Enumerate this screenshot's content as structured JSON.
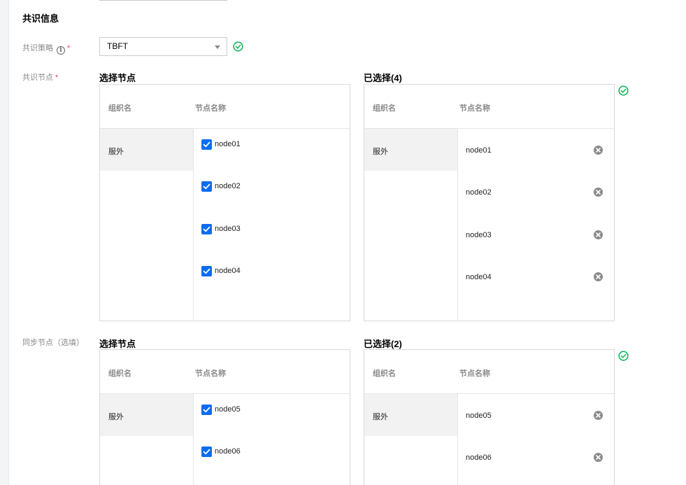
{
  "section": {
    "title": "共识信息"
  },
  "consensus": {
    "label": "共识策略",
    "info_glyph": "i",
    "required_mark": "*",
    "value": "TBFT",
    "status_icon": "check-circle-icon",
    "status_color": "#16b85c"
  },
  "consensus_nodes": {
    "label": "共识节点",
    "required_mark": "*",
    "select_title": "选择节点",
    "selected_title": "已选择(4)",
    "col_org": "组织名",
    "col_node": "节点名称",
    "org": "服外",
    "nodes": [
      "node01",
      "node02",
      "node03",
      "node04"
    ],
    "selected": [
      "node01",
      "node02",
      "node03",
      "node04"
    ]
  },
  "sync_nodes": {
    "label": "同步节点（选填）",
    "select_title": "选择节点",
    "selected_title": "已选择(2)",
    "col_org": "组织名",
    "col_node": "节点名称",
    "org": "服外",
    "nodes": [
      "node05",
      "node06"
    ],
    "selected": [
      "node05",
      "node06"
    ]
  },
  "colors": {
    "accent": "#0c6cf2",
    "success": "#16b85c",
    "required": "#e54545"
  }
}
